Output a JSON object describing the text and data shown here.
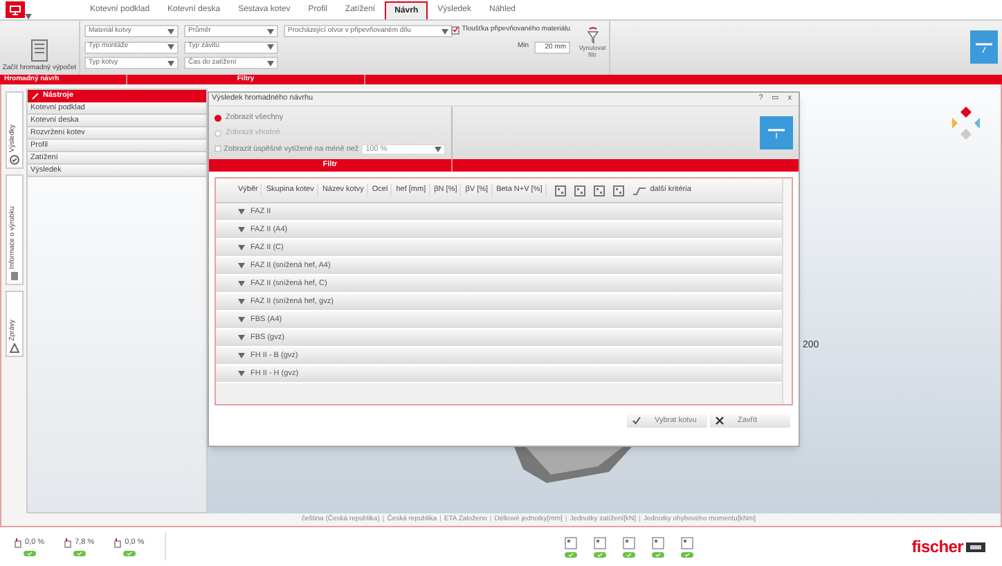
{
  "tabs": [
    {
      "label": "Kotevní podklad",
      "selected": false
    },
    {
      "label": "Kotevní deska",
      "selected": false
    },
    {
      "label": "Sestava kotev",
      "selected": false
    },
    {
      "label": "Profil",
      "selected": false
    },
    {
      "label": "Zatížení",
      "selected": false
    },
    {
      "label": "Návrh",
      "selected": true
    },
    {
      "label": "Výsledek",
      "selected": false
    },
    {
      "label": "Náhled",
      "selected": false
    }
  ],
  "ribbon": {
    "start_button": "Začít hromadný výpočet",
    "dropdowns": [
      {
        "placeholder": "Materiál kotvy"
      },
      {
        "placeholder": "Průměr"
      },
      {
        "placeholder": "Procházející otvor v připevňovaném dílu"
      },
      {
        "placeholder": "Typ montáže"
      },
      {
        "placeholder": "Typ závitu"
      },
      {
        "placeholder": "Typ kotvy"
      },
      {
        "placeholder": "Čas do zatížení"
      }
    ],
    "thickness_checkbox": {
      "label": "Tloušťka připevňovaného materiálu",
      "checked": true
    },
    "min_label": "Min",
    "min_value": "20 mm",
    "reset_button": "Vynulovat filtr",
    "group_labels": [
      "Hromadný návrh",
      "Filtry"
    ]
  },
  "side_tabs": [
    "Výsledky",
    "Informace o výrobku",
    "Zprávy"
  ],
  "sidebar": {
    "header": "Nástroje",
    "items": [
      "Kotevní podklad",
      "Kotevní deska",
      "Rozvržení kotev",
      "Profil",
      "Zatížení",
      "Výsledek"
    ]
  },
  "dialog": {
    "title": "Výsledek hromadného návrhu",
    "controls": [
      "?",
      "▭",
      "x"
    ],
    "options": [
      {
        "label": "Zobrazit všechny",
        "selected": true,
        "disabled": false
      },
      {
        "label": "Zobrazit vhodné",
        "selected": false,
        "disabled": true
      }
    ],
    "limit_option": {
      "label": "Zobrazit úspěšné vytížené na méně než",
      "checked": false,
      "value": "100 %"
    },
    "filter_label": "Filtr",
    "columns": [
      "Výběr",
      "Skupina kotev",
      "Název kotvy",
      "Ocel",
      "hef [mm]",
      "βN [%]",
      "βV [%]",
      "Beta N+V [%]"
    ],
    "more_criteria": "další kritéria",
    "rows": [
      "FAZ II",
      "FAZ II (A4)",
      "FAZ II (C)",
      "FAZ II (snížená hef, A4)",
      "FAZ II (snížená hef, C)",
      "FAZ II (snížená hef, gvz)",
      "FBS (A4)",
      "FBS (gvz)",
      "FH II - B (gvz)",
      "FH II - H (gvz)"
    ],
    "buttons": [
      "Vybrat kotvu",
      "Zavřít"
    ]
  },
  "viewport": {
    "dimension": "200"
  },
  "status_separator": "|",
  "status_bar": [
    "čeština (Česká republika)",
    "Česká republika",
    "ETA Založeno",
    "Délkové jednotky[mm]",
    "Jednotky zatížení[kN]",
    "Jednotky ohybového momentu[kNm]"
  ],
  "indicators": [
    "0,0 %",
    "7,8 %",
    "0,0 %"
  ],
  "logo": "fischer"
}
